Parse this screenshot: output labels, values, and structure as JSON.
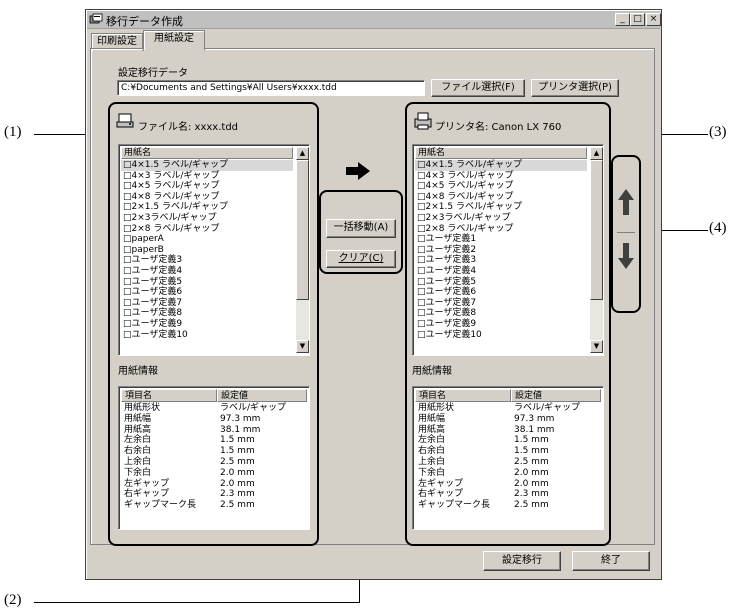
{
  "window": {
    "title": "移行データ作成",
    "tabs": [
      "印刷設定",
      "用紙設定"
    ],
    "active_tab": 1,
    "caption_buttons": {
      "minimize": "_",
      "maximize": "□",
      "close": "×"
    }
  },
  "source": {
    "label": "設定移行データ",
    "path": "C:¥Documents and Settings¥All Users¥xxxx.tdd",
    "file_button": "ファイル選択(F)",
    "printer_button": "プリンタ選択(P)"
  },
  "left": {
    "file_label": "ファイル名: xxxx.tdd",
    "list_header": "用紙名",
    "items": [
      "□4×1.5 ラベル/ギャップ",
      "□4×3 ラベル/ギャップ",
      "□4×5 ラベル/ギャップ",
      "□4×8 ラベル/ギャップ",
      "□2×1.5 ラベル/ギャップ",
      "□2×3ラベル/ギャップ",
      "□2×8 ラベル/ギャップ",
      "□paperA",
      "□paperB",
      "□ユーザ定義3",
      "□ユーザ定義4",
      "□ユーザ定義5",
      "□ユーザ定義6",
      "□ユーザ定義7",
      "□ユーザ定義8",
      "□ユーザ定義9",
      "□ユーザ定義10"
    ],
    "info_label": "用紙情報",
    "table_headers": [
      "項目名",
      "設定値"
    ],
    "rows": [
      [
        "用紙形状",
        "ラベル/ギャップ"
      ],
      [
        "用紙幅",
        "97.3 mm"
      ],
      [
        "用紙高",
        "38.1 mm"
      ],
      [
        "左余白",
        "1.5 mm"
      ],
      [
        "右余白",
        "1.5 mm"
      ],
      [
        "上余白",
        "2.5 mm"
      ],
      [
        "下余白",
        "2.0 mm"
      ],
      [
        "左ギャップ",
        "2.0 mm"
      ],
      [
        "右ギャップ",
        "2.3 mm"
      ],
      [
        "ギャップマーク長",
        "2.5 mm"
      ]
    ]
  },
  "middle": {
    "move_all_button": "一括移動(A)",
    "clear_button": "クリア(C)"
  },
  "right": {
    "printer_label": "プリンタ名:  Canon LX 760",
    "list_header": "用紙名",
    "items": [
      "□4×1.5 ラベル/ギャップ",
      "□4×3 ラベル/ギャップ",
      "□4×5 ラベル/ギャップ",
      "□4×8 ラベル/ギャップ",
      "□2×1.5 ラベル/ギャップ",
      "□2×3ラベル/ギャップ",
      "□2×8 ラベル/ギャップ",
      "□ユーザ定義1",
      "□ユーザ定義2",
      "□ユーザ定義3",
      "□ユーザ定義4",
      "□ユーザ定義5",
      "□ユーザ定義6",
      "□ユーザ定義7",
      "□ユーザ定義8",
      "□ユーザ定義9",
      "□ユーザ定義10"
    ],
    "info_label": "用紙情報",
    "table_headers": [
      "項目名",
      "設定値"
    ],
    "rows": [
      [
        "用紙形状",
        "ラベル/ギャップ"
      ],
      [
        "用紙幅",
        "97.3 mm"
      ],
      [
        "用紙高",
        "38.1 mm"
      ],
      [
        "左余白",
        "1.5 mm"
      ],
      [
        "右余白",
        "1.5 mm"
      ],
      [
        "上余白",
        "2.5 mm"
      ],
      [
        "下余白",
        "2.0 mm"
      ],
      [
        "左ギャップ",
        "2.0 mm"
      ],
      [
        "右ギャップ",
        "2.3 mm"
      ],
      [
        "ギャップマーク長",
        "2.5 mm"
      ]
    ]
  },
  "footer": {
    "migrate_button": "設定移行",
    "exit_button": "終了"
  },
  "callouts": [
    "(1)",
    "(2)",
    "(3)",
    "(4)"
  ]
}
